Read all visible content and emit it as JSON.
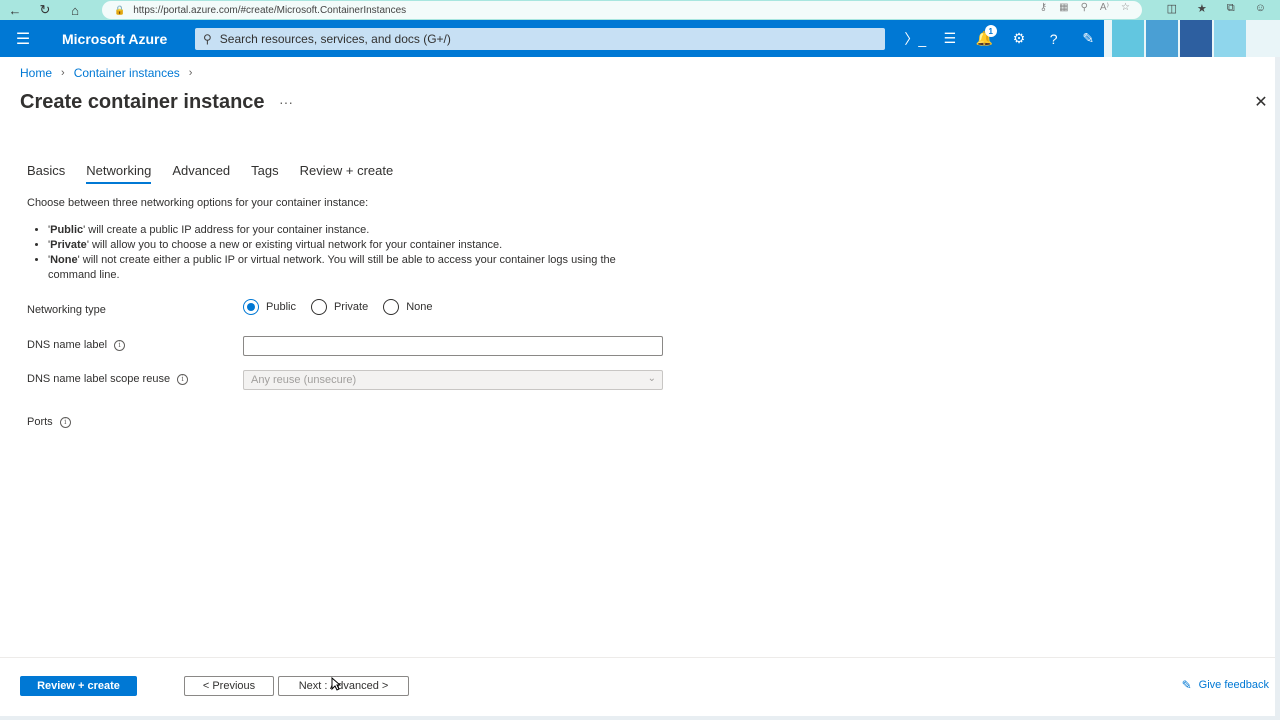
{
  "browser": {
    "url": "https://portal.azure.com/#create/Microsoft.ContainerInstances"
  },
  "topbar": {
    "brand": "Microsoft Azure",
    "search_placeholder": "Search resources, services, and docs (G+/)",
    "notification_count": "1"
  },
  "breadcrumb": {
    "home": "Home",
    "container_instances": "Container instances"
  },
  "page": {
    "title": "Create container instance",
    "more": "···"
  },
  "tabs": [
    {
      "label": "Basics"
    },
    {
      "label": "Networking"
    },
    {
      "label": "Advanced"
    },
    {
      "label": "Tags"
    },
    {
      "label": "Review + create"
    }
  ],
  "networking": {
    "intro": "Choose between three networking options for your container instance:",
    "options": [
      {
        "name": "Public",
        "desc": " will create a public IP address for your container instance."
      },
      {
        "name": "Private",
        "desc": " will allow you to choose a new or existing virtual network for your container instance."
      },
      {
        "name": "None",
        "desc": " will not create either a public IP or virtual network. You will still be able to access your container logs using the command line."
      }
    ],
    "type_label": "Networking type",
    "radio_public": "Public",
    "radio_private": "Private",
    "radio_none": "None",
    "dns_label": "DNS name label",
    "dns_value": "",
    "scope_label": "DNS name label scope reuse",
    "scope_value": "Any reuse (unsecure)",
    "ports_label": "Ports"
  },
  "footer": {
    "review_create": "Review + create",
    "previous": "< Previous",
    "next": "Next : Advanced >",
    "feedback": "Give feedback"
  }
}
